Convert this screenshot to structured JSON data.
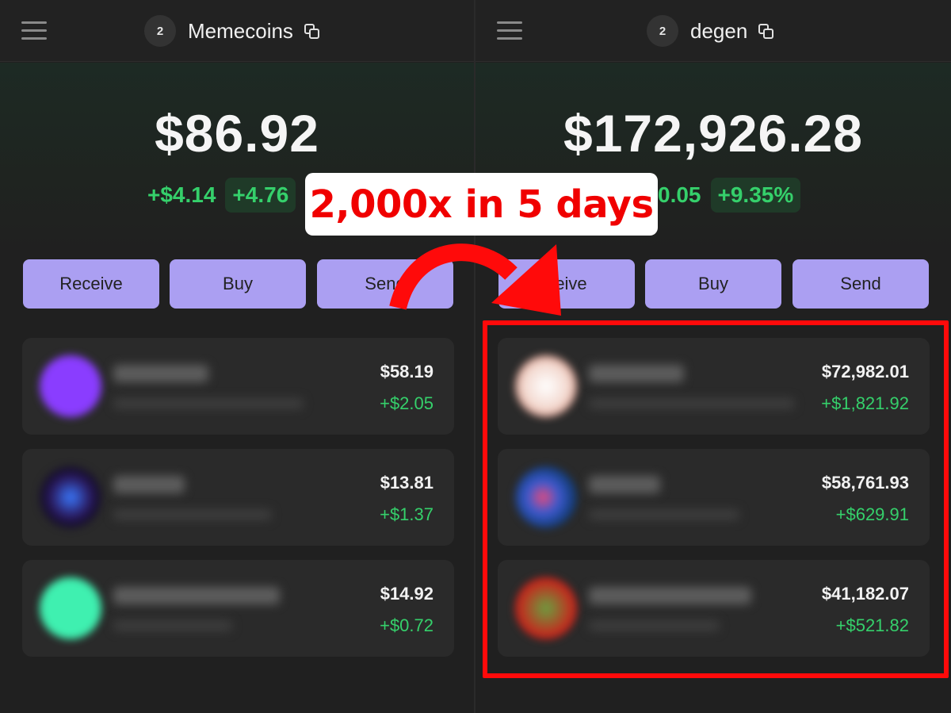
{
  "left_wallet": {
    "wallet_number": "2",
    "wallet_name": "Memecoins",
    "balance": "$86.92",
    "change_abs": "+$4.14",
    "change_pct": "+4.76",
    "buttons": {
      "receive": "Receive",
      "buy": "Buy",
      "send": "Send"
    },
    "tokens": [
      {
        "value": "$58.19",
        "change": "+$2.05",
        "avatar_color": "#8a3dff"
      },
      {
        "value": "$13.81",
        "change": "+$1.37",
        "avatar_color": "#1a1030"
      },
      {
        "value": "$14.92",
        "change": "+$0.72",
        "avatar_color": "#3ff0b0"
      }
    ]
  },
  "right_wallet": {
    "wallet_number": "2",
    "wallet_name": "degen",
    "balance": "$172,926.28",
    "change_abs": "0.05",
    "change_pct": "+9.35%",
    "buttons": {
      "receive": "ceive",
      "buy": "Buy",
      "send": "Send"
    },
    "tokens": [
      {
        "value": "$72,982.01",
        "change": "+$1,821.92",
        "avatar_color": "#f4d9d0"
      },
      {
        "value": "$58,761.93",
        "change": "+$629.91",
        "avatar_color": "#123a70"
      },
      {
        "value": "$41,182.07",
        "change": "+$521.82",
        "avatar_color": "#c8241c"
      }
    ]
  },
  "annotation": {
    "label": "2,000x in 5 days",
    "color": "#ff0a0a",
    "icon": "curved-arrow-icon"
  },
  "colors": {
    "accent_button": "#ab9ff2",
    "positive": "#35d06b",
    "background": "#202020"
  }
}
